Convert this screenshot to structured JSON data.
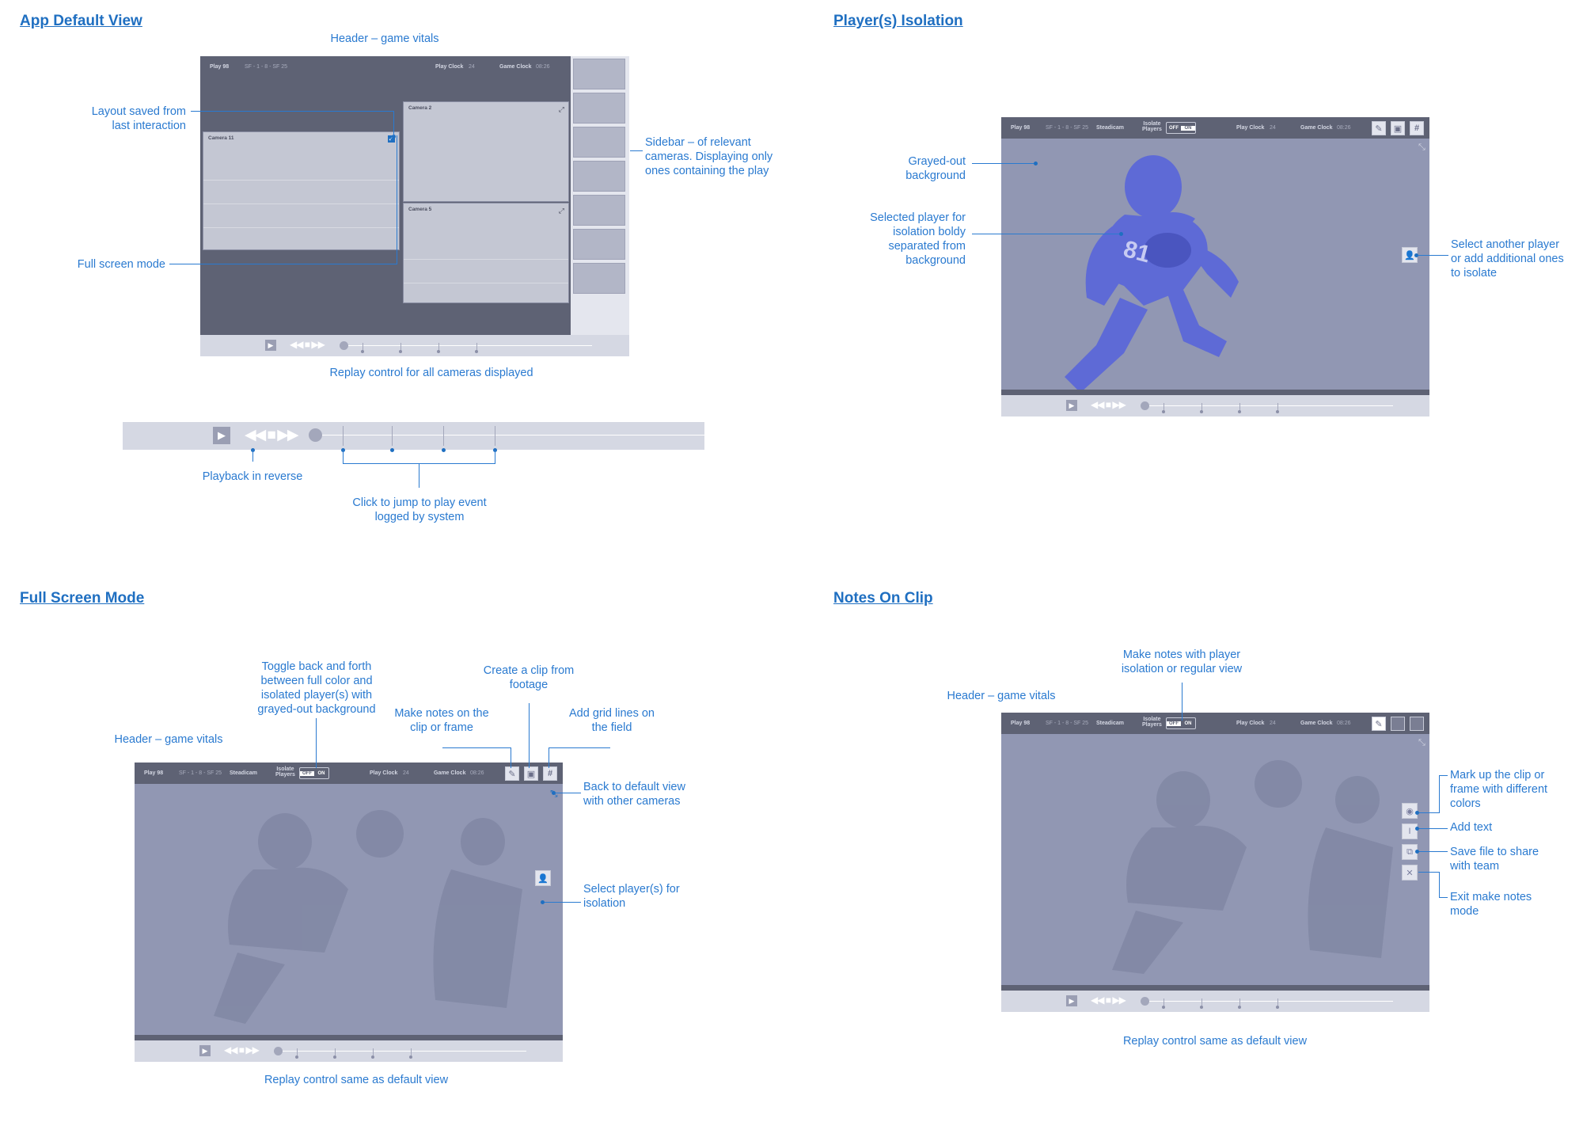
{
  "sections": {
    "default_view": "App Default View",
    "isolation": "Player(s) Isolation",
    "full_screen": "Full Screen Mode",
    "notes": "Notes On Clip"
  },
  "game_header": {
    "play": "Play 98",
    "score": "SF - 1 - 8 - SF 25",
    "camera": "Steadicam",
    "isolate": "Isolate\nPlayers",
    "toggle_off": "OFF",
    "toggle_on": "ON",
    "play_clock_label": "Play Clock",
    "play_clock_value": "24",
    "game_clock_label": "Game Clock",
    "game_clock_value": "08:26"
  },
  "default_view": {
    "cameras": [
      "Camera 11",
      "Camera 2",
      "Camera 5"
    ],
    "annotations": {
      "header": "Header – game vitals",
      "layout": "Layout saved from\nlast interaction",
      "sidebar": "Sidebar – of relevant\ncameras. Displaying only\nones containing the play",
      "full_screen": "Full screen mode",
      "replay": "Replay control for all cameras displayed",
      "reverse": "Playback in reverse",
      "jump": "Click to jump to play event\nlogged by system"
    }
  },
  "isolation": {
    "annotations": {
      "grayed": "Grayed-out\nbackground",
      "selected": "Selected player for\nisolation boldy\nseparated from\nbackground",
      "another": "Select another player\nor add additional ones\nto isolate"
    }
  },
  "full_screen": {
    "annotations": {
      "toggle": "Toggle back and forth\nbetween full color and\nisolated player(s) with\ngrayed-out background",
      "clip": "Create a clip from\nfootage",
      "notes": "Make notes on the\nclip or frame",
      "grid": "Add grid lines on\nthe field",
      "header": "Header – game vitals",
      "back": "Back to default view\nwith other cameras",
      "select": "Select player(s) for\nisolation",
      "replay": "Replay control same as default view"
    }
  },
  "notes": {
    "annotations": {
      "make_notes": "Make notes with player\nisolation or regular view",
      "header": "Header – game vitals",
      "markup": "Mark up the clip or\nframe with different\ncolors",
      "text": "Add text",
      "save": "Save file to share\nwith team",
      "exit": "Exit make notes\nmode",
      "replay": "Replay control same as default view"
    }
  },
  "colors": {
    "accent": "#1f6fc1",
    "header_bar": "#5e6274",
    "grayed": "#9197b3",
    "isolated_player": "#5e6ad6"
  },
  "icons": [
    "play-icon",
    "rewind-icon",
    "stop-icon",
    "fast-forward-icon",
    "pencil-icon",
    "clip-icon",
    "grid-icon",
    "collapse-icon",
    "expand-icon",
    "player-select-icon",
    "palette-icon",
    "text-icon",
    "save-icon",
    "close-icon"
  ]
}
